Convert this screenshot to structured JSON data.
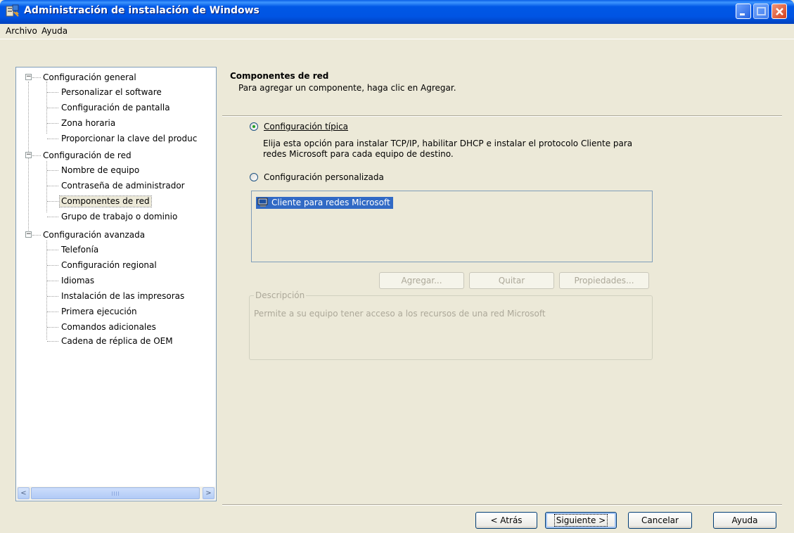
{
  "window": {
    "title": "Administración de instalación de Windows"
  },
  "menu": {
    "items": [
      "Archivo",
      "Ayuda"
    ]
  },
  "tree": {
    "groups": [
      {
        "label": "Configuración general",
        "expander": "−",
        "children": [
          "Personalizar el software",
          "Configuración de pantalla",
          "Zona horaria",
          "Proporcionar la clave del produc"
        ]
      },
      {
        "label": "Configuración de red",
        "expander": "−",
        "children": [
          "Nombre de equipo",
          "Contraseña de administrador",
          "Componentes de red",
          "Grupo de trabajo o dominio"
        ]
      },
      {
        "label": "Configuración avanzada",
        "expander": "−",
        "children": [
          "Telefonía",
          "Configuración regional",
          "Idiomas",
          "Instalación de las impresoras",
          "Primera ejecución",
          "Comandos adicionales",
          "Cadena de réplica de OEM"
        ]
      }
    ],
    "selected": "Componentes de red",
    "scroll_left_glyph": "<",
    "scroll_right_glyph": ">"
  },
  "page": {
    "title": "Componentes de red",
    "subtitle": "Para agregar un componente, haga clic en Agregar."
  },
  "options": {
    "typical_label": "Configuración típica",
    "typical_description": "Elija esta opción para instalar TCP/IP, habilitar DHCP e instalar el protocolo Cliente para redes Microsoft para cada equipo de destino.",
    "custom_label": "Configuración personalizada",
    "selected": "typical"
  },
  "components": {
    "items": [
      "Cliente para redes Microsoft"
    ]
  },
  "component_buttons": {
    "add": "Agregar...",
    "remove": "Quitar",
    "properties": "Propiedades..."
  },
  "description": {
    "legend": "Descripción",
    "text": "Permite a su equipo tener acceso a los recursos de una red Microsoft"
  },
  "wizard_buttons": {
    "back": "< Atrás",
    "next": "Siguiente >",
    "cancel": "Cancelar",
    "help": "Ayuda"
  },
  "colors": {
    "titlebar": "#0054E3",
    "selection": "#316AC5",
    "dialog_bg": "#ECE9D8",
    "disabled_text": "#ACA899"
  }
}
